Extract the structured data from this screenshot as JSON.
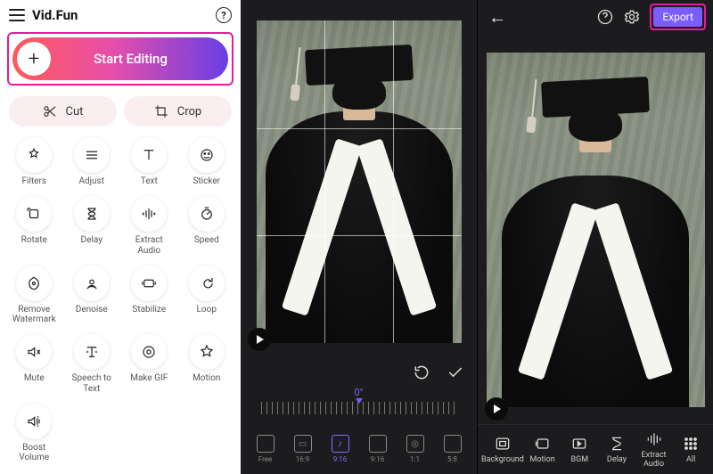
{
  "left": {
    "app_title": "Vid.Fun",
    "help_glyph": "?",
    "start_label": "Start Editing",
    "plus_glyph": "+",
    "cut_label": "Cut",
    "crop_label": "Crop",
    "tools": [
      {
        "icon": "filters-icon",
        "label": "Filters"
      },
      {
        "icon": "adjust-icon",
        "label": "Adjust"
      },
      {
        "icon": "text-icon",
        "label": "Text"
      },
      {
        "icon": "sticker-icon",
        "label": "Sticker"
      },
      {
        "icon": "rotate-icon",
        "label": "Rotate"
      },
      {
        "icon": "delay-icon",
        "label": "Delay"
      },
      {
        "icon": "extract-audio-icon",
        "label": "Extract\nAudio"
      },
      {
        "icon": "speed-icon",
        "label": "Speed"
      },
      {
        "icon": "remove-watermark-icon",
        "label": "Remove\nWatermark"
      },
      {
        "icon": "denoise-icon",
        "label": "Denoise"
      },
      {
        "icon": "stabilize-icon",
        "label": "Stabilize"
      },
      {
        "icon": "loop-icon",
        "label": "Loop"
      },
      {
        "icon": "mute-icon",
        "label": "Mute"
      },
      {
        "icon": "speech-to-text-icon",
        "label": "Speech to\nText"
      },
      {
        "icon": "make-gif-icon",
        "label": "Make GIF"
      },
      {
        "icon": "motion-icon",
        "label": "Motion"
      },
      {
        "icon": "boost-volume-icon",
        "label": "Boost\nVolume"
      }
    ]
  },
  "mid": {
    "angle_label": "0°",
    "aspects": [
      {
        "name": "aspect-free",
        "label": "Free",
        "selected": false,
        "glyph": ""
      },
      {
        "name": "aspect-16-9",
        "label": "16:9",
        "selected": false,
        "glyph": "▭"
      },
      {
        "name": "aspect-9-16-tiktok",
        "label": "9:16",
        "selected": true,
        "glyph": "♪"
      },
      {
        "name": "aspect-9-16",
        "label": "9:16",
        "selected": false,
        "glyph": ""
      },
      {
        "name": "aspect-1-1",
        "label": "1:1",
        "selected": false,
        "glyph": "◎"
      },
      {
        "name": "aspect-5-8",
        "label": "5:8",
        "selected": false,
        "glyph": ""
      }
    ]
  },
  "right": {
    "export_label": "Export",
    "tools": [
      {
        "name": "background",
        "label": "Background"
      },
      {
        "name": "motion",
        "label": "Motion"
      },
      {
        "name": "bgm",
        "label": "BGM"
      },
      {
        "name": "delay",
        "label": "Delay"
      },
      {
        "name": "extract-audio",
        "label": "Extract Audio"
      },
      {
        "name": "all",
        "label": "All"
      }
    ]
  },
  "colors": {
    "highlight": "#e91a9c",
    "accent": "#7a5cff"
  }
}
